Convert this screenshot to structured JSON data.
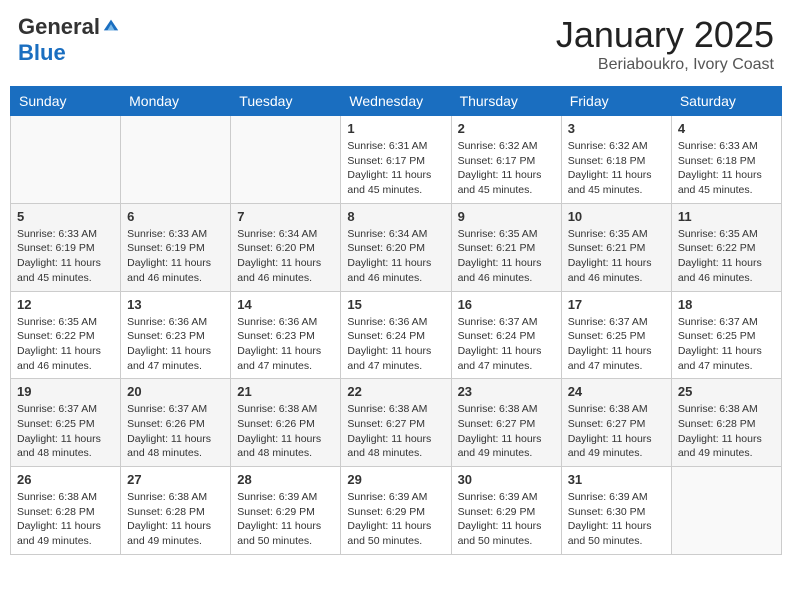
{
  "header": {
    "logo_general": "General",
    "logo_blue": "Blue",
    "month_title": "January 2025",
    "location": "Beriaboukro, Ivory Coast"
  },
  "days_of_week": [
    "Sunday",
    "Monday",
    "Tuesday",
    "Wednesday",
    "Thursday",
    "Friday",
    "Saturday"
  ],
  "weeks": [
    [
      {
        "day": "",
        "info": ""
      },
      {
        "day": "",
        "info": ""
      },
      {
        "day": "",
        "info": ""
      },
      {
        "day": "1",
        "info": "Sunrise: 6:31 AM\nSunset: 6:17 PM\nDaylight: 11 hours and 45 minutes."
      },
      {
        "day": "2",
        "info": "Sunrise: 6:32 AM\nSunset: 6:17 PM\nDaylight: 11 hours and 45 minutes."
      },
      {
        "day": "3",
        "info": "Sunrise: 6:32 AM\nSunset: 6:18 PM\nDaylight: 11 hours and 45 minutes."
      },
      {
        "day": "4",
        "info": "Sunrise: 6:33 AM\nSunset: 6:18 PM\nDaylight: 11 hours and 45 minutes."
      }
    ],
    [
      {
        "day": "5",
        "info": "Sunrise: 6:33 AM\nSunset: 6:19 PM\nDaylight: 11 hours and 45 minutes."
      },
      {
        "day": "6",
        "info": "Sunrise: 6:33 AM\nSunset: 6:19 PM\nDaylight: 11 hours and 46 minutes."
      },
      {
        "day": "7",
        "info": "Sunrise: 6:34 AM\nSunset: 6:20 PM\nDaylight: 11 hours and 46 minutes."
      },
      {
        "day": "8",
        "info": "Sunrise: 6:34 AM\nSunset: 6:20 PM\nDaylight: 11 hours and 46 minutes."
      },
      {
        "day": "9",
        "info": "Sunrise: 6:35 AM\nSunset: 6:21 PM\nDaylight: 11 hours and 46 minutes."
      },
      {
        "day": "10",
        "info": "Sunrise: 6:35 AM\nSunset: 6:21 PM\nDaylight: 11 hours and 46 minutes."
      },
      {
        "day": "11",
        "info": "Sunrise: 6:35 AM\nSunset: 6:22 PM\nDaylight: 11 hours and 46 minutes."
      }
    ],
    [
      {
        "day": "12",
        "info": "Sunrise: 6:35 AM\nSunset: 6:22 PM\nDaylight: 11 hours and 46 minutes."
      },
      {
        "day": "13",
        "info": "Sunrise: 6:36 AM\nSunset: 6:23 PM\nDaylight: 11 hours and 47 minutes."
      },
      {
        "day": "14",
        "info": "Sunrise: 6:36 AM\nSunset: 6:23 PM\nDaylight: 11 hours and 47 minutes."
      },
      {
        "day": "15",
        "info": "Sunrise: 6:36 AM\nSunset: 6:24 PM\nDaylight: 11 hours and 47 minutes."
      },
      {
        "day": "16",
        "info": "Sunrise: 6:37 AM\nSunset: 6:24 PM\nDaylight: 11 hours and 47 minutes."
      },
      {
        "day": "17",
        "info": "Sunrise: 6:37 AM\nSunset: 6:25 PM\nDaylight: 11 hours and 47 minutes."
      },
      {
        "day": "18",
        "info": "Sunrise: 6:37 AM\nSunset: 6:25 PM\nDaylight: 11 hours and 47 minutes."
      }
    ],
    [
      {
        "day": "19",
        "info": "Sunrise: 6:37 AM\nSunset: 6:25 PM\nDaylight: 11 hours and 48 minutes."
      },
      {
        "day": "20",
        "info": "Sunrise: 6:37 AM\nSunset: 6:26 PM\nDaylight: 11 hours and 48 minutes."
      },
      {
        "day": "21",
        "info": "Sunrise: 6:38 AM\nSunset: 6:26 PM\nDaylight: 11 hours and 48 minutes."
      },
      {
        "day": "22",
        "info": "Sunrise: 6:38 AM\nSunset: 6:27 PM\nDaylight: 11 hours and 48 minutes."
      },
      {
        "day": "23",
        "info": "Sunrise: 6:38 AM\nSunset: 6:27 PM\nDaylight: 11 hours and 49 minutes."
      },
      {
        "day": "24",
        "info": "Sunrise: 6:38 AM\nSunset: 6:27 PM\nDaylight: 11 hours and 49 minutes."
      },
      {
        "day": "25",
        "info": "Sunrise: 6:38 AM\nSunset: 6:28 PM\nDaylight: 11 hours and 49 minutes."
      }
    ],
    [
      {
        "day": "26",
        "info": "Sunrise: 6:38 AM\nSunset: 6:28 PM\nDaylight: 11 hours and 49 minutes."
      },
      {
        "day": "27",
        "info": "Sunrise: 6:38 AM\nSunset: 6:28 PM\nDaylight: 11 hours and 49 minutes."
      },
      {
        "day": "28",
        "info": "Sunrise: 6:39 AM\nSunset: 6:29 PM\nDaylight: 11 hours and 50 minutes."
      },
      {
        "day": "29",
        "info": "Sunrise: 6:39 AM\nSunset: 6:29 PM\nDaylight: 11 hours and 50 minutes."
      },
      {
        "day": "30",
        "info": "Sunrise: 6:39 AM\nSunset: 6:29 PM\nDaylight: 11 hours and 50 minutes."
      },
      {
        "day": "31",
        "info": "Sunrise: 6:39 AM\nSunset: 6:30 PM\nDaylight: 11 hours and 50 minutes."
      },
      {
        "day": "",
        "info": ""
      }
    ]
  ]
}
